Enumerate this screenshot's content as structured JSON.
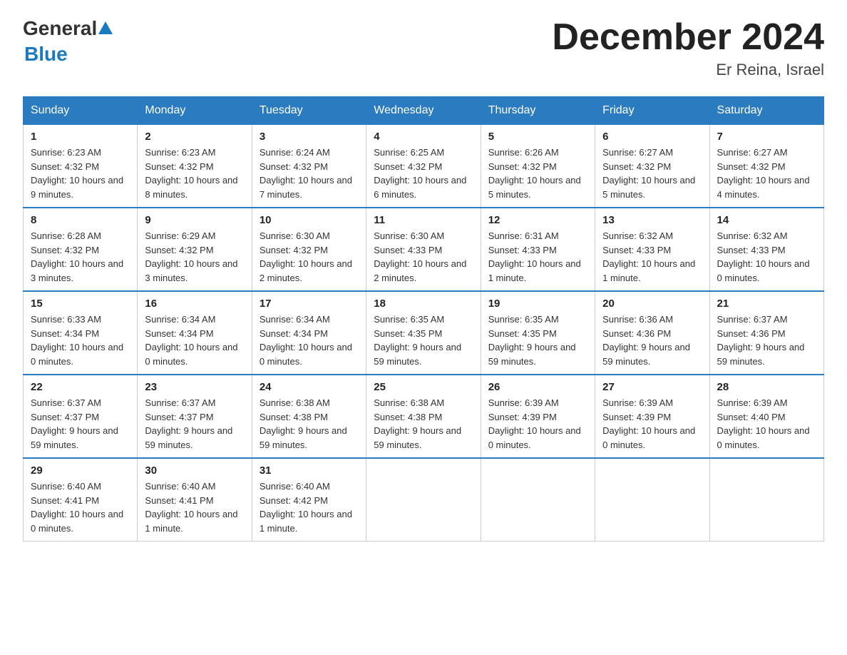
{
  "header": {
    "logo_general": "General",
    "logo_blue": "Blue",
    "title": "December 2024",
    "subtitle": "Er Reina, Israel"
  },
  "columns": [
    "Sunday",
    "Monday",
    "Tuesday",
    "Wednesday",
    "Thursday",
    "Friday",
    "Saturday"
  ],
  "weeks": [
    [
      {
        "day": "1",
        "sunrise": "6:23 AM",
        "sunset": "4:32 PM",
        "daylight": "10 hours and 9 minutes."
      },
      {
        "day": "2",
        "sunrise": "6:23 AM",
        "sunset": "4:32 PM",
        "daylight": "10 hours and 8 minutes."
      },
      {
        "day": "3",
        "sunrise": "6:24 AM",
        "sunset": "4:32 PM",
        "daylight": "10 hours and 7 minutes."
      },
      {
        "day": "4",
        "sunrise": "6:25 AM",
        "sunset": "4:32 PM",
        "daylight": "10 hours and 6 minutes."
      },
      {
        "day": "5",
        "sunrise": "6:26 AM",
        "sunset": "4:32 PM",
        "daylight": "10 hours and 5 minutes."
      },
      {
        "day": "6",
        "sunrise": "6:27 AM",
        "sunset": "4:32 PM",
        "daylight": "10 hours and 5 minutes."
      },
      {
        "day": "7",
        "sunrise": "6:27 AM",
        "sunset": "4:32 PM",
        "daylight": "10 hours and 4 minutes."
      }
    ],
    [
      {
        "day": "8",
        "sunrise": "6:28 AM",
        "sunset": "4:32 PM",
        "daylight": "10 hours and 3 minutes."
      },
      {
        "day": "9",
        "sunrise": "6:29 AM",
        "sunset": "4:32 PM",
        "daylight": "10 hours and 3 minutes."
      },
      {
        "day": "10",
        "sunrise": "6:30 AM",
        "sunset": "4:32 PM",
        "daylight": "10 hours and 2 minutes."
      },
      {
        "day": "11",
        "sunrise": "6:30 AM",
        "sunset": "4:33 PM",
        "daylight": "10 hours and 2 minutes."
      },
      {
        "day": "12",
        "sunrise": "6:31 AM",
        "sunset": "4:33 PM",
        "daylight": "10 hours and 1 minute."
      },
      {
        "day": "13",
        "sunrise": "6:32 AM",
        "sunset": "4:33 PM",
        "daylight": "10 hours and 1 minute."
      },
      {
        "day": "14",
        "sunrise": "6:32 AM",
        "sunset": "4:33 PM",
        "daylight": "10 hours and 0 minutes."
      }
    ],
    [
      {
        "day": "15",
        "sunrise": "6:33 AM",
        "sunset": "4:34 PM",
        "daylight": "10 hours and 0 minutes."
      },
      {
        "day": "16",
        "sunrise": "6:34 AM",
        "sunset": "4:34 PM",
        "daylight": "10 hours and 0 minutes."
      },
      {
        "day": "17",
        "sunrise": "6:34 AM",
        "sunset": "4:34 PM",
        "daylight": "10 hours and 0 minutes."
      },
      {
        "day": "18",
        "sunrise": "6:35 AM",
        "sunset": "4:35 PM",
        "daylight": "9 hours and 59 minutes."
      },
      {
        "day": "19",
        "sunrise": "6:35 AM",
        "sunset": "4:35 PM",
        "daylight": "9 hours and 59 minutes."
      },
      {
        "day": "20",
        "sunrise": "6:36 AM",
        "sunset": "4:36 PM",
        "daylight": "9 hours and 59 minutes."
      },
      {
        "day": "21",
        "sunrise": "6:37 AM",
        "sunset": "4:36 PM",
        "daylight": "9 hours and 59 minutes."
      }
    ],
    [
      {
        "day": "22",
        "sunrise": "6:37 AM",
        "sunset": "4:37 PM",
        "daylight": "9 hours and 59 minutes."
      },
      {
        "day": "23",
        "sunrise": "6:37 AM",
        "sunset": "4:37 PM",
        "daylight": "9 hours and 59 minutes."
      },
      {
        "day": "24",
        "sunrise": "6:38 AM",
        "sunset": "4:38 PM",
        "daylight": "9 hours and 59 minutes."
      },
      {
        "day": "25",
        "sunrise": "6:38 AM",
        "sunset": "4:38 PM",
        "daylight": "9 hours and 59 minutes."
      },
      {
        "day": "26",
        "sunrise": "6:39 AM",
        "sunset": "4:39 PM",
        "daylight": "10 hours and 0 minutes."
      },
      {
        "day": "27",
        "sunrise": "6:39 AM",
        "sunset": "4:39 PM",
        "daylight": "10 hours and 0 minutes."
      },
      {
        "day": "28",
        "sunrise": "6:39 AM",
        "sunset": "4:40 PM",
        "daylight": "10 hours and 0 minutes."
      }
    ],
    [
      {
        "day": "29",
        "sunrise": "6:40 AM",
        "sunset": "4:41 PM",
        "daylight": "10 hours and 0 minutes."
      },
      {
        "day": "30",
        "sunrise": "6:40 AM",
        "sunset": "4:41 PM",
        "daylight": "10 hours and 1 minute."
      },
      {
        "day": "31",
        "sunrise": "6:40 AM",
        "sunset": "4:42 PM",
        "daylight": "10 hours and 1 minute."
      },
      null,
      null,
      null,
      null
    ]
  ],
  "labels": {
    "sunrise": "Sunrise:",
    "sunset": "Sunset:",
    "daylight": "Daylight:"
  }
}
